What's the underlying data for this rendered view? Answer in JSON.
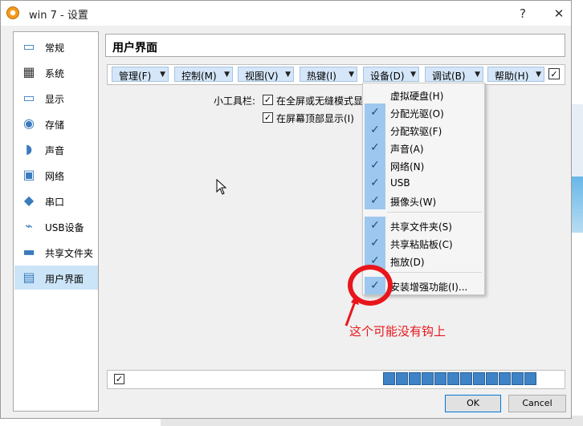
{
  "window": {
    "title": "win 7 - 设置",
    "help_glyph": "?",
    "close_glyph": "✕"
  },
  "sidebar": {
    "items": [
      {
        "label": "常规",
        "icon": "monitor-icon",
        "glyph": "▭",
        "selected": false
      },
      {
        "label": "系统",
        "icon": "chip-icon",
        "glyph": "▦",
        "selected": false
      },
      {
        "label": "显示",
        "icon": "display-icon",
        "glyph": "▭",
        "selected": false
      },
      {
        "label": "存储",
        "icon": "disk-icon",
        "glyph": "◉",
        "selected": false
      },
      {
        "label": "声音",
        "icon": "speaker-icon",
        "glyph": "◗",
        "selected": false
      },
      {
        "label": "网络",
        "icon": "network-icon",
        "glyph": "▣",
        "selected": false
      },
      {
        "label": "串口",
        "icon": "serial-port-icon",
        "glyph": "◆",
        "selected": false
      },
      {
        "label": "USB设备",
        "icon": "usb-icon",
        "glyph": "⌁",
        "selected": false
      },
      {
        "label": "共享文件夹",
        "icon": "folder-icon",
        "glyph": "▬",
        "selected": false
      },
      {
        "label": "用户界面",
        "icon": "ui-icon",
        "glyph": "▤",
        "selected": true
      }
    ]
  },
  "page": {
    "title": "用户界面"
  },
  "menubar": {
    "menus": [
      "管理(F)",
      "控制(M)",
      "视图(V)",
      "热键(I)",
      "设备(D)",
      "调试(B)",
      "帮助(H)"
    ],
    "arrow": "▼",
    "enabled_check": "☑"
  },
  "options": {
    "mini_toolbar_label": "小工具栏:",
    "fullscreen_option": "在全屏或无缝模式显",
    "top_option": "在屏幕顶部显示(I)",
    "check": "✓"
  },
  "devices_menu": {
    "items": [
      {
        "label": "虚拟硬盘(H)",
        "checked": false
      },
      {
        "label": "分配光驱(O)",
        "checked": true
      },
      {
        "label": "分配软驱(F)",
        "checked": true
      },
      {
        "label": "声音(A)",
        "checked": true
      },
      {
        "label": "网络(N)",
        "checked": true
      },
      {
        "label": "USB",
        "checked": true
      },
      {
        "label": "摄像头(W)",
        "checked": true
      },
      {
        "label": "共享文件夹(S)",
        "checked": true
      },
      {
        "label": "共享粘贴板(C)",
        "checked": true
      },
      {
        "label": "拖放(D)",
        "checked": true
      },
      {
        "label": "安装增强功能(I)...",
        "checked": true
      }
    ],
    "check_glyph": "✓"
  },
  "annotation": {
    "text": "这个可能没有钩上",
    "color": "#e8161c"
  },
  "statusbar": {
    "enabled_check": "☑",
    "icons": [
      "hard-disk-icon",
      "optical-icon",
      "audio-icon",
      "floppy-icon",
      "usb-icon",
      "shared-folder-icon",
      "display-icon",
      "video-capture-icon",
      "cpu-icon",
      "keyboard-icon",
      "mouse-icon",
      "arrow-down-icon"
    ]
  },
  "buttons": {
    "ok": "OK",
    "cancel": "Cancel"
  },
  "colors": {
    "selection": "#cce4f7",
    "menu_button": "#d4e6f8",
    "check_bg": "#9dc7ee",
    "annotation": "#e8161c"
  }
}
